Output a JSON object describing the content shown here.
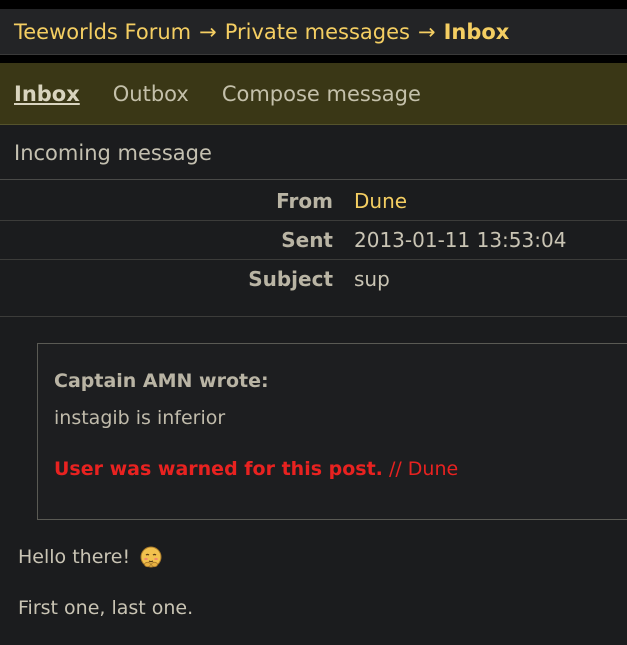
{
  "breadcrumb": {
    "items": [
      "Teeworlds Forum",
      "Private messages"
    ],
    "separator": "→",
    "current": "Inbox"
  },
  "tabs": [
    {
      "label": "Inbox",
      "active": true
    },
    {
      "label": "Outbox",
      "active": false
    },
    {
      "label": "Compose message",
      "active": false
    }
  ],
  "section": {
    "title": "Incoming message"
  },
  "meta": {
    "from_label": "From",
    "from_value": "Dune",
    "sent_label": "Sent",
    "sent_value": "2013-01-11 13:53:04",
    "subject_label": "Subject",
    "subject_value": "sup"
  },
  "quote": {
    "author": "Captain AMN wrote:",
    "text": "instagib is inferior",
    "warning": "User was warned for this post.",
    "warning_by": "// Dune"
  },
  "message": {
    "line1": "Hello there!",
    "emoji": "shy-face-icon",
    "line2": "First one, last one."
  },
  "colors": {
    "accent": "#f4ce62",
    "warning": "#e82220",
    "tabbar_bg": "#3a3716"
  }
}
